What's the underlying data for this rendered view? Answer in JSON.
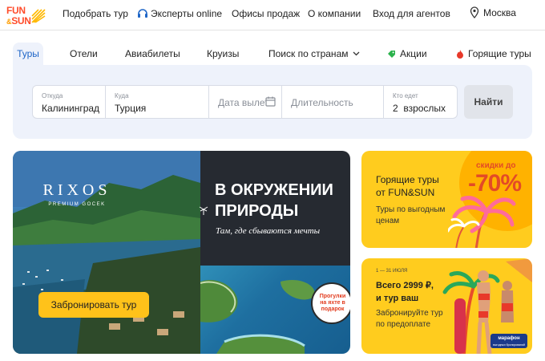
{
  "brand": {
    "logo_line1": "FUN",
    "logo_amp": "&",
    "logo_line2": "SUN"
  },
  "nav": {
    "links": [
      "Подобрать тур",
      "Эксперты online",
      "Офисы продаж",
      "О компании",
      "Вход для агентов"
    ],
    "city": "Москва",
    "icons": {
      "experts": "headset-icon",
      "city": "location-pin-icon"
    }
  },
  "tabs": [
    {
      "label": "Туры",
      "active": true
    },
    {
      "label": "Отели"
    },
    {
      "label": "Авиабилеты"
    },
    {
      "label": "Круизы"
    },
    {
      "label": "Поиск по странам",
      "icon": "chevron-down-icon"
    },
    {
      "label": "Акции",
      "icon": "tag-icon"
    },
    {
      "label": "Горящие туры",
      "icon": "flame-icon"
    }
  ],
  "search": {
    "from_label": "Откуда",
    "from_value": "Калининград",
    "to_label": "Куда",
    "to_value": "Турция",
    "date_placeholder": "Дата вылета",
    "duration_placeholder": "Длительность",
    "travelers_label": "Кто едет",
    "travelers_value": "2  взрослых",
    "submit_label": "Найти"
  },
  "hero": {
    "hotel_name": "RIXOS",
    "hotel_sub": "PREMIUM GOCEK",
    "headline": "В ОКРУЖЕНИИ\nПРИРОДЫ",
    "tagline": "Там, где сбываются мечты",
    "badge": "Прогулки на яхте в подарок",
    "cta": "Забронировать тур"
  },
  "promo_hot": {
    "title": "Горящие туры\nот FUN&SUN",
    "subtitle": "Туры по выгодным\nценам",
    "sale_small": "скидки до",
    "sale_big": "-70%"
  },
  "promo_marathon": {
    "dates": "1 — 31 ИЮЛЯ",
    "title": "Всего 2999 ₽,\nи тур ваш",
    "subtitle": "Забронируйте тур\nпо предоплате",
    "badge": "марафон",
    "badge_sub": "выгодных бронирований"
  },
  "colors": {
    "accent_blue": "#1f66c7",
    "panel_bg": "#eef2fb",
    "promo_yellow": "#ffcc1e",
    "cta_yellow": "#ffc21a",
    "sale_red": "#e34a27"
  }
}
